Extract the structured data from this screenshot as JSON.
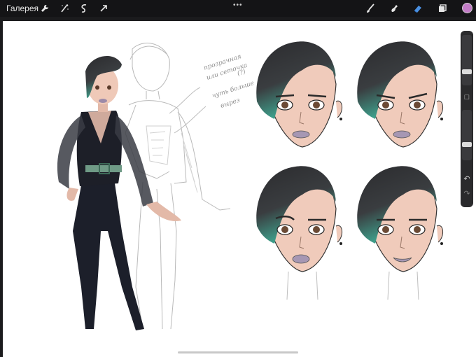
{
  "app": {
    "gallery_label": "Галерея",
    "menu_dots": "•••"
  },
  "toolbar_left": [
    {
      "name": "wrench-icon"
    },
    {
      "name": "magic-wand-icon"
    },
    {
      "name": "selection-icon"
    },
    {
      "name": "transform-arrow-icon"
    }
  ],
  "toolbar_right": [
    {
      "name": "brush-icon"
    },
    {
      "name": "smudge-icon"
    },
    {
      "name": "eraser-icon",
      "active_color": "#4a90e2"
    },
    {
      "name": "layers-icon"
    }
  ],
  "current_color": "#c27cc6",
  "sidebar": {
    "brush_size_level": 0.25,
    "opacity_level": 0.3,
    "modify_label": "□",
    "undo_label": "↶",
    "redo_label": "↷"
  },
  "sketch_notes": {
    "line1": "прозрачная",
    "line2": "или сеточка",
    "line3": "(?)",
    "line4": "чуть больше",
    "line5": "вырез"
  }
}
